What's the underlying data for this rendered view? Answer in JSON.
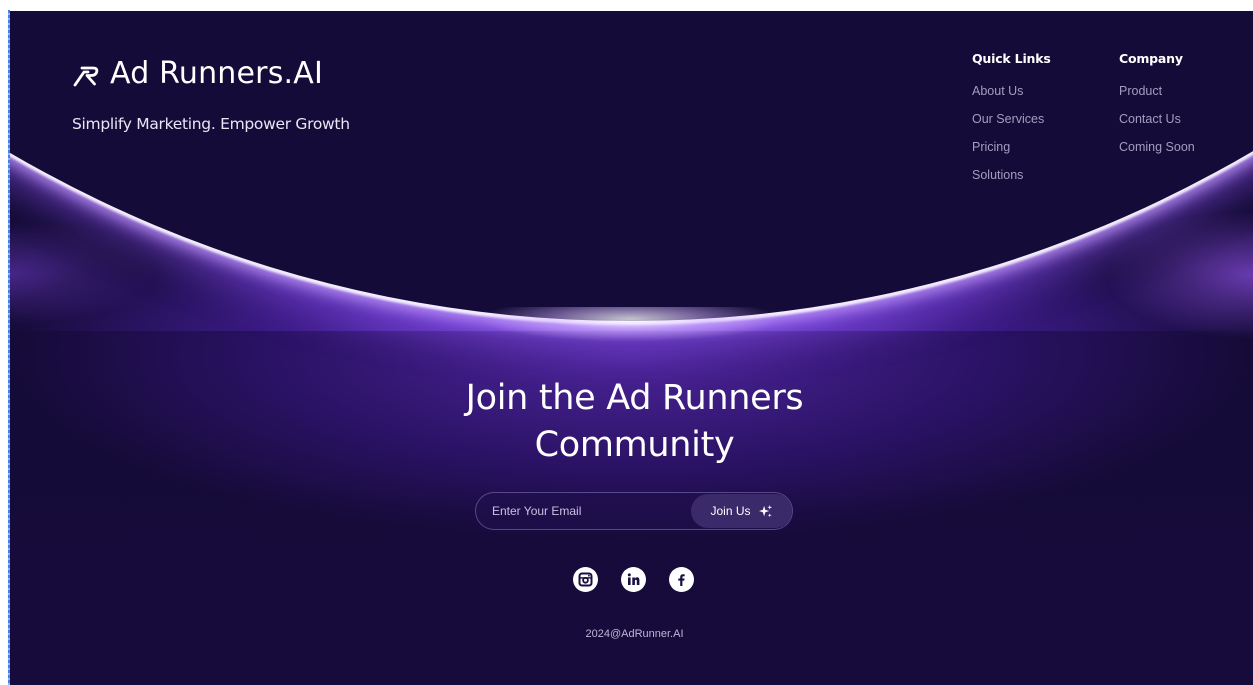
{
  "brand": {
    "logo_icon": "ad-runners-logo-icon",
    "name": "Ad Runners.AI",
    "tagline": "Simplify Marketing. Empower Growth"
  },
  "footer_nav": {
    "quick_links": {
      "heading": "Quick Links",
      "items": [
        "About Us",
        "Our Services",
        "Pricing",
        "Solutions"
      ]
    },
    "company": {
      "heading": "Company",
      "items": [
        "Product",
        "Contact Us",
        "Coming Soon"
      ]
    }
  },
  "join": {
    "title_line1": "Join the Ad Runners",
    "title_line2": "Community",
    "email_placeholder": "Enter Your Email",
    "email_value": "",
    "button_label": "Join Us",
    "button_icon": "sparkle-icon"
  },
  "socials": [
    {
      "name": "instagram",
      "icon": "instagram-icon"
    },
    {
      "name": "linkedin",
      "icon": "linkedin-icon"
    },
    {
      "name": "facebook",
      "icon": "facebook-icon"
    }
  ],
  "copyright": "2024@AdRunner.AI",
  "colors": {
    "background": "#150b38",
    "glow": "#7a3aeb",
    "link_muted": "#a49dc0",
    "button_bg": "#3a2a6a"
  }
}
